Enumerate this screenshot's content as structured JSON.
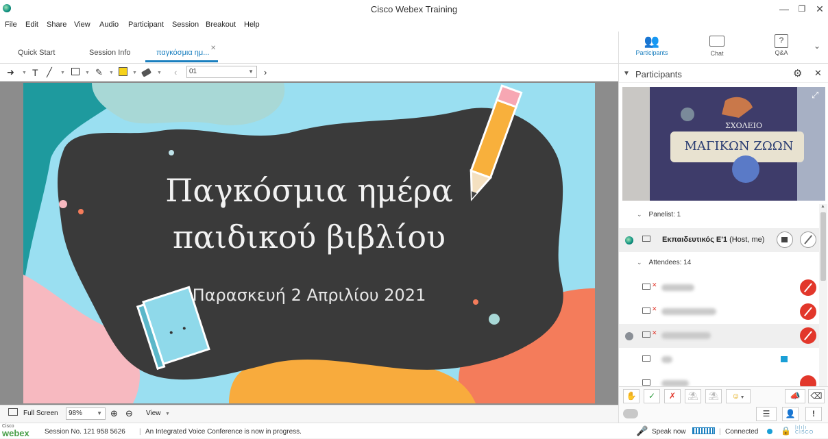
{
  "window": {
    "title": "Cisco Webex Training"
  },
  "menu": [
    "File",
    "Edit",
    "Share",
    "View",
    "Audio",
    "Participant",
    "Session",
    "Breakout",
    "Help"
  ],
  "tabs": {
    "quick_start": "Quick Start",
    "session_info": "Session Info",
    "document": "παγκόσμια ημ..."
  },
  "toolbar": {
    "page_value": "01"
  },
  "slide": {
    "title_line1": "Παγκόσμια ημέρα",
    "title_line2": "παιδικού βιβλίου",
    "date": "Παρασκευή 2 Απριλίου 2021"
  },
  "bottombar": {
    "full_screen": "Full Screen",
    "zoom": "98%",
    "view": "View"
  },
  "statusbar": {
    "session": "Session No. 121 958 5626",
    "audio_msg": "An Integrated Voice Conference is now in progress.",
    "speak_now": "Speak now",
    "connected": "Connected",
    "logo_top": "Cisco",
    "logo_bottom": "webex",
    "cisco": "CISCO"
  },
  "panel": {
    "tab_participants": "Participants",
    "tab_chat": "Chat",
    "tab_qa": "Q&A",
    "header": "Participants",
    "video_sign_line1": "ΣΧΟΛΕΙΟ",
    "video_sign_line2": "ΜΑΓΙΚΩΝ ΖΩΩΝ",
    "panelist_group": "Panelist: 1",
    "host_name": "Εκπαιδευτικός Ε'1",
    "host_role": "(Host, me)",
    "attendees_group": "Attendees: 14"
  },
  "colors": {
    "accent": "#1a7fbf",
    "mute_red": "#e2372b",
    "chalkboard": "#3a3a3a"
  }
}
